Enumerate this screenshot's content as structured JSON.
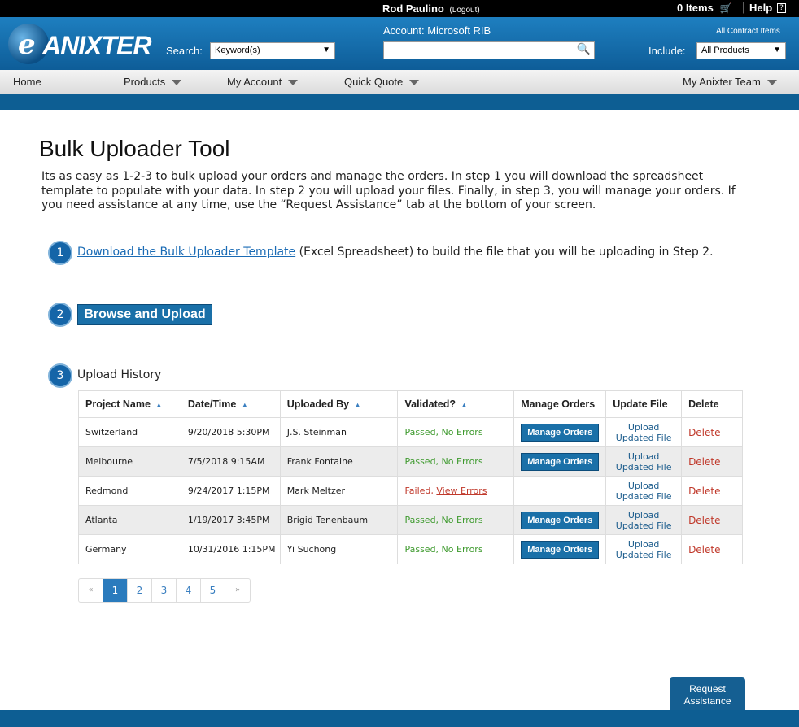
{
  "topbar": {
    "user_name": "Rod Paulino",
    "logout": "(Logout)",
    "items": "0 Items",
    "cart_icon": "shopping-cart",
    "separator": "|",
    "help": "Help",
    "help_box": "?"
  },
  "header": {
    "logo_letter": "e",
    "logo_word": "ANIXTER",
    "search_label": "Search:",
    "search_select": "Keyword(s)",
    "account": "Account: Microsoft RIB",
    "all_contract": "All Contract Items",
    "include_label": "Include:",
    "include_select": "All Products"
  },
  "nav": {
    "home": "Home",
    "products": "Products",
    "my_account": "My Account",
    "quick_quote": "Quick Quote",
    "team": "My Anixter Team"
  },
  "main": {
    "title": "Bulk Uploader Tool",
    "intro": "Its as easy as 1-2-3 to bulk upload your orders and manage the orders. In step 1 you will download the spreadsheet template to populate with your data. In step 2 you will upload your files. Finally, in step 3, you will manage your orders. If you need assistance at any time, use the “Request Assistance” tab at the bottom of your screen.",
    "step1_num": "1",
    "step1_link": "Download the Bulk Uploader Template",
    "step1_rest": " (Excel Spreadsheet) to build the file that you will be uploading in Step 2.",
    "step2_num": "2",
    "browse_label": "Browse and Upload",
    "step3_num": "3",
    "history_label": "Upload History"
  },
  "table": {
    "headers": [
      "Project Name",
      "Date/Time",
      "Uploaded By",
      "Validated?",
      "Manage Orders",
      "Update File",
      "Delete"
    ],
    "sort_icon": "⬍",
    "rows": [
      {
        "project": "Switzerland",
        "date": "9/20/2018 5:30PM",
        "by": "J.S. Steinman",
        "validated": "Passed, No Errors",
        "manage": "Manage Orders",
        "upload1": "Upload",
        "upload2": "Updated File",
        "delete": "Delete"
      },
      {
        "project": "Melbourne",
        "date": "7/5/2018 9:15AM",
        "by": "Frank Fontaine",
        "validated": "Passed, No Errors",
        "manage": "Manage Orders",
        "upload1": "Upload",
        "upload2": "Updated File",
        "delete": "Delete"
      },
      {
        "project": "Redmond",
        "date": "9/24/2017 1:15PM",
        "by": "Mark Meltzer",
        "validated": "Failed, ",
        "view_errors": "View Errors",
        "upload1": "Upload",
        "upload2": "Updated File",
        "delete": "Delete"
      },
      {
        "project": "Atlanta",
        "date": "1/19/2017 3:45PM",
        "by": "Brigid Tenenbaum",
        "validated": "Passed, No Errors",
        "manage": "Manage Orders",
        "upload1": "Upload",
        "upload2": "Updated File",
        "delete": "Delete"
      },
      {
        "project": "Germany",
        "date": "10/31/2016 1:15PM",
        "by": "Yi Suchong",
        "validated": "Passed, No Errors",
        "manage": "Manage Orders",
        "upload1": "Upload",
        "upload2": "Updated File",
        "delete": "Delete"
      }
    ]
  },
  "pagination": {
    "prev": "«",
    "pages": [
      "1",
      "2",
      "3",
      "4",
      "5"
    ],
    "next": "»",
    "current": "1"
  },
  "assist": {
    "line1": "Request",
    "line2": "Assistance"
  }
}
